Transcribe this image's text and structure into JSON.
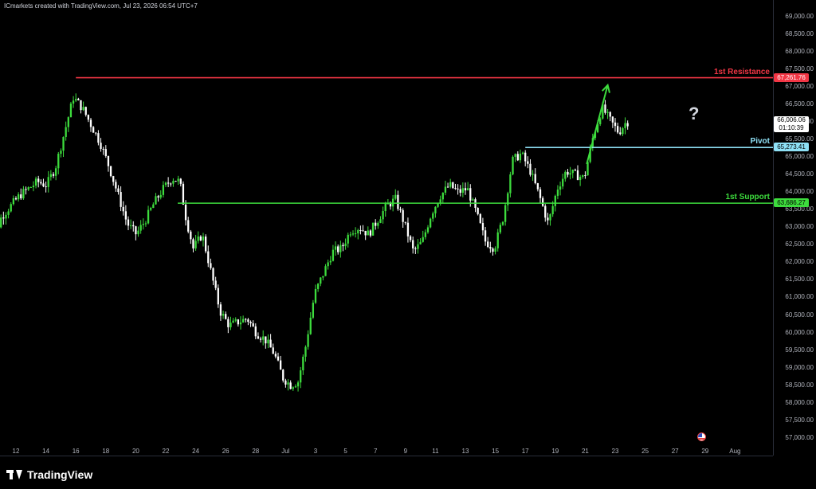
{
  "header": {
    "attribution": "ICmarkets created with TradingView.com, Jul 23, 2026 06:54 UTC+7"
  },
  "branding": {
    "logo_text": "TradingView"
  },
  "annotation": {
    "question_mark": "?"
  },
  "chart_data": {
    "type": "candlestick",
    "title": "",
    "xlabel": "",
    "ylabel": "",
    "ylim": [
      56750,
      69250
    ],
    "y_ticks": [
      "69,000.00",
      "68,500.00",
      "68,000.00",
      "67,500.00",
      "67,000.00",
      "66,500.00",
      "66,000.00",
      "65,500.00",
      "65,000.00",
      "64,500.00",
      "64,000.00",
      "63,500.00",
      "63,000.00",
      "62,500.00",
      "62,000.00",
      "61,500.00",
      "61,000.00",
      "60,500.00",
      "60,000.00",
      "59,500.00",
      "59,000.00",
      "58,500.00",
      "58,000.00",
      "57,500.00",
      "57,000.00"
    ],
    "x_ticks": [
      "12",
      "14",
      "16",
      "18",
      "20",
      "22",
      "24",
      "26",
      "28",
      "Jul",
      "3",
      "5",
      "7",
      "9",
      "11",
      "13",
      "15",
      "17",
      "19",
      "21",
      "23",
      "25",
      "27",
      "29",
      "Aug"
    ],
    "levels": [
      {
        "name": "1st Resistance",
        "price": 67261.76,
        "price_label": "67,261.76",
        "color": "#f23645",
        "from_day": 16
      },
      {
        "name": "Pivot",
        "price": 65273.41,
        "price_label": "65,273.41",
        "color": "#8ee0f5",
        "from_day": 46
      },
      {
        "name": "1st Support",
        "price": 63686.27,
        "price_label": "63,686.27",
        "color": "#3ddc3d",
        "from_day": 22.8
      }
    ],
    "current_price": {
      "price": 66006.06,
      "price_label": "66,006.06",
      "countdown": "01:10:39"
    },
    "projection_arrow": {
      "from": [
        50.1,
        64800
      ],
      "to": [
        51.5,
        67050
      ],
      "color": "#3ddc3d"
    },
    "up_color": "#3ddc3d",
    "down_color": "#ffffff",
    "path": [
      [
        10.0,
        61800
      ],
      [
        10.6,
        62600
      ],
      [
        11.2,
        63300
      ],
      [
        11.8,
        63600
      ],
      [
        12.4,
        63900
      ],
      [
        13.0,
        64100
      ],
      [
        13.6,
        64300
      ],
      [
        14.2,
        64200
      ],
      [
        14.8,
        64700
      ],
      [
        15.4,
        65700
      ],
      [
        16.0,
        66700
      ],
      [
        16.6,
        66400
      ],
      [
        17.2,
        65900
      ],
      [
        17.8,
        65400
      ],
      [
        18.4,
        64700
      ],
      [
        19.0,
        63900
      ],
      [
        19.6,
        63100
      ],
      [
        20.2,
        62800
      ],
      [
        20.8,
        63200
      ],
      [
        21.4,
        63700
      ],
      [
        22.0,
        64100
      ],
      [
        22.6,
        64400
      ],
      [
        23.1,
        64300
      ],
      [
        23.5,
        63300
      ],
      [
        24.0,
        62400
      ],
      [
        24.6,
        62800
      ],
      [
        25.2,
        61700
      ],
      [
        25.8,
        60600
      ],
      [
        26.4,
        60200
      ],
      [
        27.0,
        60300
      ],
      [
        27.6,
        60400
      ],
      [
        28.2,
        60000
      ],
      [
        28.8,
        59800
      ],
      [
        29.4,
        59400
      ],
      [
        30.0,
        58700
      ],
      [
        30.5,
        58500
      ],
      [
        31.0,
        58600
      ],
      [
        31.5,
        59600
      ],
      [
        32.1,
        61100
      ],
      [
        32.7,
        61700
      ],
      [
        33.3,
        62300
      ],
      [
        33.9,
        62400
      ],
      [
        34.5,
        62900
      ],
      [
        35.1,
        63000
      ],
      [
        35.7,
        62800
      ],
      [
        36.3,
        63200
      ],
      [
        36.9,
        63600
      ],
      [
        37.5,
        63800
      ],
      [
        38.1,
        63100
      ],
      [
        38.7,
        62300
      ],
      [
        39.3,
        62600
      ],
      [
        39.9,
        63400
      ],
      [
        40.5,
        63900
      ],
      [
        41.1,
        64200
      ],
      [
        41.7,
        64000
      ],
      [
        42.3,
        64100
      ],
      [
        42.9,
        63400
      ],
      [
        43.5,
        62600
      ],
      [
        44.1,
        62400
      ],
      [
        44.7,
        63300
      ],
      [
        45.3,
        64900
      ],
      [
        45.9,
        65100
      ],
      [
        46.5,
        64600
      ],
      [
        47.1,
        63900
      ],
      [
        47.7,
        63100
      ],
      [
        48.3,
        64100
      ],
      [
        48.9,
        64600
      ],
      [
        49.5,
        64500
      ],
      [
        50.1,
        64400
      ],
      [
        50.7,
        65600
      ],
      [
        51.3,
        66400
      ],
      [
        51.9,
        66000
      ],
      [
        52.4,
        65700
      ],
      [
        52.9,
        66006
      ]
    ]
  }
}
